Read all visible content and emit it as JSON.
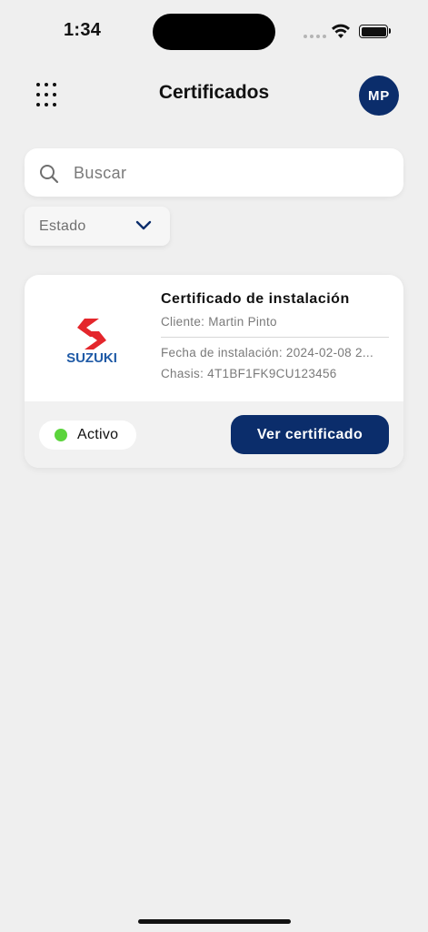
{
  "status_bar": {
    "time": "1:34"
  },
  "header": {
    "title": "Certificados",
    "avatar_initials": "MP",
    "menu_icon": "grid-dots-icon"
  },
  "search": {
    "placeholder": "Buscar",
    "value": "",
    "icon": "search-icon"
  },
  "filter": {
    "label": "Estado",
    "icon": "chevron-down-icon"
  },
  "certificates": [
    {
      "brand": "SUZUKI",
      "title": "Certificado de instalación",
      "client": "Cliente: Martin Pinto",
      "install_date": "Fecha de instalación: 2024-02-08 2...",
      "chasis": "Chasis: 4T1BF1FK9CU123456",
      "status": "Activo",
      "action_label": "Ver certificado"
    }
  ],
  "colors": {
    "primary": "#0b2d6b",
    "status_active": "#5bd43c",
    "background": "#efefef",
    "brand_red": "#e4262c",
    "brand_blue": "#1f5aa6"
  }
}
